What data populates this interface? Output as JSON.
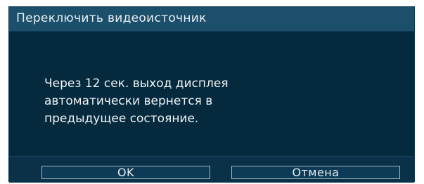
{
  "dialog": {
    "title": "Переключить видеоисточник",
    "message_lines": [
      "Через 12 сек. выход дисплея",
      "автоматически вернется в",
      "предыдущее состояние."
    ],
    "buttons": {
      "ok_label": "OK",
      "cancel_label": "Отмена"
    }
  },
  "colors": {
    "dialog_background": "#062a3d",
    "title_bar": "#1b4f6c",
    "button_border": "#9fb6c4",
    "text": "#eef3f6"
  }
}
